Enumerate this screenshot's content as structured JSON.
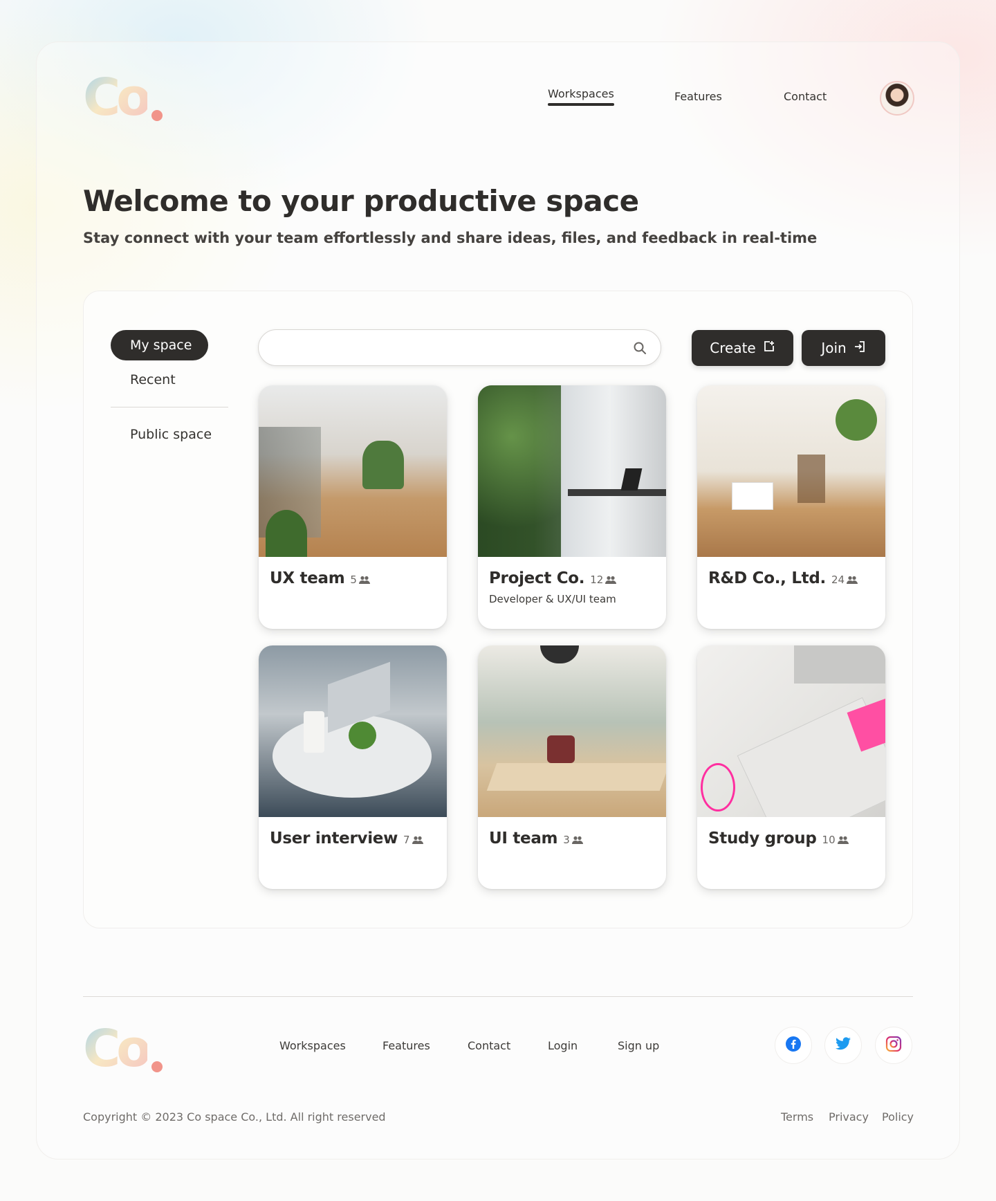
{
  "header": {
    "logo_text": "Co",
    "nav": [
      {
        "label": "Workspaces",
        "active": true
      },
      {
        "label": "Features",
        "active": false
      },
      {
        "label": "Contact",
        "active": false
      }
    ]
  },
  "hero": {
    "title": "Welcome to your productive space",
    "subtitle": "Stay connect with your team effortlessly and share ideas, files, and feedback in real-time"
  },
  "sidebar": {
    "items": [
      {
        "label": "My space",
        "selected": true
      },
      {
        "label": "Recent",
        "selected": false
      },
      {
        "label": "Public space",
        "selected": false
      }
    ]
  },
  "search": {
    "placeholder": "",
    "value": "",
    "icon": "search-icon"
  },
  "actions": {
    "create_label": "Create",
    "create_icon": "create-icon",
    "join_label": "Join",
    "join_icon": "join-icon"
  },
  "workspaces": [
    {
      "title": "UX team",
      "members": "5",
      "description": "",
      "image": "office-lounge-photo"
    },
    {
      "title": "Project Co.",
      "members": "12",
      "description": "Developer & UX/UI team",
      "image": "window-desk-plants-photo"
    },
    {
      "title": "R&D Co., Ltd.",
      "members": "24",
      "description": "",
      "image": "bright-hallway-photo"
    },
    {
      "title": "User interview",
      "members": "7",
      "description": "",
      "image": "laptops-coffee-table-photo"
    },
    {
      "title": "UI team",
      "members": "3",
      "description": "",
      "image": "coworking-room-photo"
    },
    {
      "title": "Study group",
      "members": "10",
      "description": "",
      "image": "planner-sticky-notes-photo"
    }
  ],
  "footer": {
    "logo_text": "Co",
    "links": [
      "Workspaces",
      "Features",
      "Contact",
      "Login",
      "Sign up"
    ],
    "social": [
      "facebook-icon",
      "twitter-icon",
      "instagram-icon"
    ],
    "copyright": "Copyright © 2023 Co space Co., Ltd.  All right reserved",
    "legal": [
      "Terms",
      "Privacy",
      "Policy"
    ]
  },
  "colors": {
    "primary_dark": "#2f2d2b",
    "logo_gradient": [
      "#a9d4ea",
      "#f7e7c3",
      "#f6c5c0"
    ],
    "logo_dot": "#f1948a",
    "facebook": "#1877f2",
    "twitter": "#1d9bf0"
  }
}
